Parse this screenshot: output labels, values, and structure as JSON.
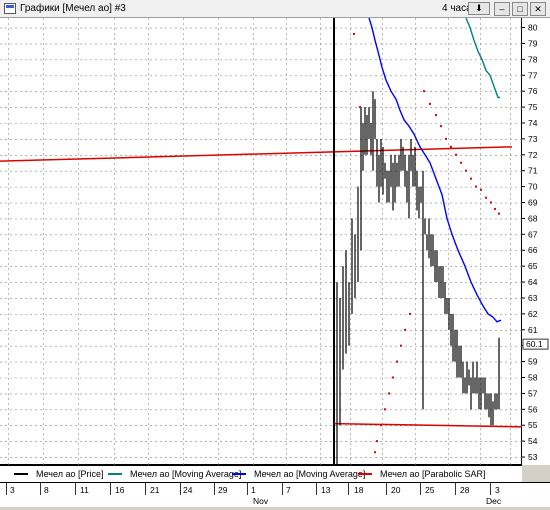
{
  "window": {
    "title": "Графики [Мечел ао] #3",
    "timeframe": "4 часа",
    "timeframe_button": "⬇"
  },
  "legend": [
    {
      "label": "Мечел ао [Price]",
      "color": "#000000"
    },
    {
      "label": "Мечел ао [Moving Average]",
      "color": "#008080"
    },
    {
      "label": "Мечел ао [Moving Average]",
      "color": "#0000ff"
    },
    {
      "label": "Мечел ао [Parabolic SAR]",
      "color": "#e00000"
    }
  ],
  "price_axis": {
    "min": 52.5,
    "max": 80.6,
    "ticks": [
      53,
      54,
      55,
      56,
      57,
      58,
      59,
      60,
      61,
      62,
      63,
      64,
      65,
      66,
      67,
      68,
      69,
      70,
      71,
      72,
      73,
      74,
      75,
      76,
      77,
      78,
      79,
      80
    ],
    "last_price_label": "60.1",
    "last_price": 60.1
  },
  "time_axis": {
    "labels": [
      "3",
      "8",
      "11",
      "16",
      "21",
      "24",
      "29",
      "1",
      "7",
      "13",
      "18",
      "20",
      "25",
      "28",
      "3"
    ],
    "month_labels": [
      "Nov",
      "Dec"
    ]
  },
  "chart_data": {
    "type": "line",
    "series": [
      {
        "name": "Мечел ао [Price]",
        "color": "#000000",
        "bars": [
          [
            334,
            75.5,
            60
          ],
          [
            337,
            64,
            52.5
          ],
          [
            340,
            63,
            55
          ],
          [
            343,
            65,
            58.5
          ],
          [
            346,
            66,
            59.5
          ],
          [
            349,
            64,
            60
          ],
          [
            352,
            68,
            62
          ],
          [
            355,
            67,
            63
          ],
          [
            358,
            70,
            64
          ],
          [
            361,
            75,
            66
          ],
          [
            363,
            74,
            71
          ],
          [
            365,
            75,
            72
          ],
          [
            367,
            74.5,
            72
          ],
          [
            369,
            75,
            73
          ],
          [
            371,
            74,
            72
          ],
          [
            373,
            76,
            71
          ],
          [
            375,
            75.5,
            73
          ],
          [
            377,
            73,
            70
          ],
          [
            379,
            72,
            69
          ],
          [
            381,
            73,
            70
          ],
          [
            383,
            72.5,
            69.5
          ],
          [
            385,
            71.5,
            70.5
          ],
          [
            387,
            71,
            69
          ],
          [
            389,
            71,
            69
          ],
          [
            391,
            72,
            70
          ],
          [
            393,
            71.5,
            68.5
          ],
          [
            395,
            72,
            69
          ],
          [
            397,
            71.5,
            70
          ],
          [
            399,
            72,
            70
          ],
          [
            401,
            73,
            71
          ],
          [
            403,
            72.5,
            71
          ],
          [
            405,
            72,
            70
          ],
          [
            407,
            71,
            69
          ],
          [
            409,
            72,
            68
          ],
          [
            411,
            73,
            71
          ],
          [
            413,
            72,
            70
          ],
          [
            415,
            72.5,
            70
          ],
          [
            417,
            71,
            68.5
          ],
          [
            419,
            70,
            68
          ],
          [
            421,
            70,
            69
          ],
          [
            423,
            71,
            56
          ],
          [
            425,
            68,
            67
          ],
          [
            427,
            67,
            66
          ],
          [
            429,
            68,
            65.5
          ],
          [
            431,
            67,
            65
          ],
          [
            433,
            67,
            65
          ],
          [
            435,
            66,
            64
          ],
          [
            437,
            66,
            64
          ],
          [
            439,
            65,
            63
          ],
          [
            441,
            65,
            63
          ],
          [
            443,
            65,
            63
          ],
          [
            445,
            64,
            62
          ],
          [
            447,
            63,
            62
          ],
          [
            449,
            63,
            61
          ],
          [
            451,
            62,
            60
          ],
          [
            453,
            62,
            59
          ],
          [
            455,
            61,
            59
          ],
          [
            457,
            61,
            58
          ],
          [
            459,
            60,
            58
          ],
          [
            461,
            60,
            58
          ],
          [
            463,
            59,
            57
          ],
          [
            465,
            58,
            57
          ],
          [
            467,
            59,
            57
          ],
          [
            469,
            58.5,
            57.5
          ],
          [
            471,
            58,
            56
          ],
          [
            473,
            59,
            57
          ],
          [
            475,
            58,
            57
          ],
          [
            477,
            59,
            57
          ],
          [
            479,
            58,
            56
          ],
          [
            481,
            58,
            56
          ],
          [
            483,
            58,
            57
          ],
          [
            485,
            58,
            56
          ],
          [
            487,
            57,
            56
          ],
          [
            489,
            57,
            55.5
          ],
          [
            491,
            57,
            55
          ],
          [
            493,
            56.5,
            55
          ],
          [
            495,
            57,
            56
          ],
          [
            497,
            57,
            56
          ],
          [
            499,
            60.5,
            56
          ]
        ]
      },
      {
        "name": "Мечел ао [Moving Average]",
        "color": "#008080",
        "points": [
          [
            466,
            80.6
          ],
          [
            470,
            80
          ],
          [
            474,
            79.2
          ],
          [
            478,
            78.5
          ],
          [
            482,
            78
          ],
          [
            486,
            77.3
          ],
          [
            490,
            77
          ],
          [
            494,
            76.3
          ],
          [
            498,
            75.6
          ],
          [
            500,
            75.6
          ]
        ]
      },
      {
        "name": "Мечел ао [Moving Average]",
        "color": "#0000ff",
        "points": [
          [
            369,
            80.6
          ],
          [
            372,
            80
          ],
          [
            375,
            79.2
          ],
          [
            378,
            78.5
          ],
          [
            382,
            77.5
          ],
          [
            386,
            76.7
          ],
          [
            391,
            76
          ],
          [
            396,
            75.5
          ],
          [
            400,
            74.8
          ],
          [
            404,
            74.2
          ],
          [
            409,
            73.8
          ],
          [
            414,
            73.3
          ],
          [
            420,
            72.5
          ],
          [
            425,
            72
          ],
          [
            430,
            71.5
          ],
          [
            436,
            70.5
          ],
          [
            442,
            69.5
          ],
          [
            447,
            68
          ],
          [
            452,
            67
          ],
          [
            458,
            66
          ],
          [
            465,
            65
          ],
          [
            471,
            64
          ],
          [
            477,
            63.2
          ],
          [
            483,
            62.5
          ],
          [
            488,
            62
          ],
          [
            493,
            61.8
          ],
          [
            497,
            61.5
          ],
          [
            501,
            61.6
          ]
        ]
      },
      {
        "name": "Мечел ао [Parabolic SAR]",
        "color": "#e00000",
        "points": [
          [
            354,
            79.6
          ],
          [
            360,
            75
          ],
          [
            375,
            53.3
          ],
          [
            377,
            54
          ],
          [
            381,
            55
          ],
          [
            385,
            56
          ],
          [
            389,
            57
          ],
          [
            393,
            58
          ],
          [
            397,
            59
          ],
          [
            401,
            60
          ],
          [
            405,
            61
          ],
          [
            410,
            62
          ],
          [
            424,
            76
          ],
          [
            430,
            75.2
          ],
          [
            436,
            74.5
          ],
          [
            441,
            73.8
          ],
          [
            446,
            73
          ],
          [
            451,
            72.5
          ],
          [
            456,
            72
          ],
          [
            461,
            71.5
          ],
          [
            466,
            71
          ],
          [
            471,
            70.5
          ],
          [
            476,
            70
          ],
          [
            481,
            69.8
          ],
          [
            486,
            69.3
          ],
          [
            491,
            69
          ],
          [
            495,
            68.6
          ],
          [
            499,
            68.3
          ]
        ]
      }
    ],
    "horizontal_lines": [
      {
        "color": "#e00000",
        "from": [
          0,
          71.6
        ],
        "to": [
          512,
          72.5
        ]
      },
      {
        "color": "#e00000",
        "from": [
          334,
          55.1
        ],
        "to": [
          522,
          54.9
        ]
      }
    ],
    "vertical_marker_x": 334,
    "ylim": [
      52.5,
      80.6
    ],
    "grid": true
  }
}
